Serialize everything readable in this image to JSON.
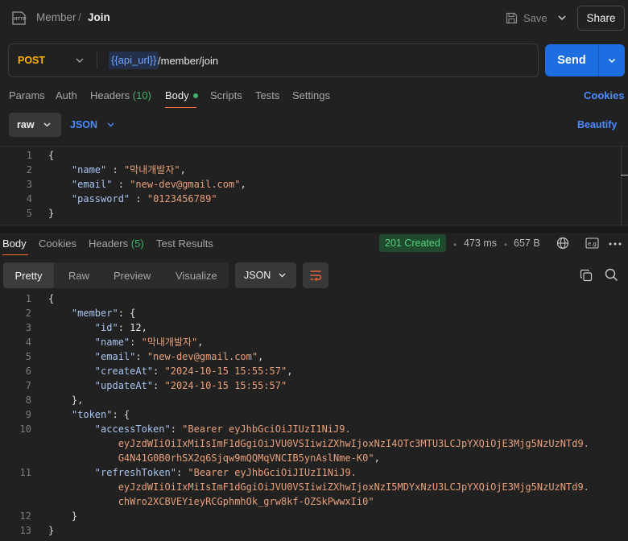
{
  "header": {
    "breadcrumb_parent": "Member",
    "breadcrumb_sep": "/",
    "breadcrumb_current": "Join",
    "save_label": "Save",
    "share_label": "Share",
    "http_icon": "http-icon"
  },
  "request": {
    "method": "POST",
    "url_variable": "{{api_url}}",
    "url_path": "/member/join",
    "send_label": "Send",
    "tabs": [
      {
        "label": "Params"
      },
      {
        "label": "Auth"
      },
      {
        "label": "Headers",
        "count": "(10)"
      },
      {
        "label": "Body"
      },
      {
        "label": "Scripts"
      },
      {
        "label": "Tests"
      },
      {
        "label": "Settings"
      }
    ],
    "cookies_label": "Cookies",
    "body_mode": "raw",
    "body_format": "JSON",
    "beautify_label": "Beautify",
    "body_lines": [
      {
        "n": "1",
        "parts": [
          [
            "p",
            "{"
          ]
        ]
      },
      {
        "n": "2",
        "parts": [
          [
            "p",
            "    "
          ],
          [
            "k",
            "\"name\""
          ],
          [
            "p",
            " : "
          ],
          [
            "s",
            "\"막내개발자\""
          ],
          [
            "p",
            ","
          ]
        ]
      },
      {
        "n": "3",
        "parts": [
          [
            "p",
            "    "
          ],
          [
            "k",
            "\"email\""
          ],
          [
            "p",
            " : "
          ],
          [
            "s",
            "\"new-dev@gmail.com\""
          ],
          [
            "p",
            ","
          ]
        ]
      },
      {
        "n": "4",
        "parts": [
          [
            "p",
            "    "
          ],
          [
            "k",
            "\"password\""
          ],
          [
            "p",
            " : "
          ],
          [
            "s",
            "\"0123456789\""
          ]
        ]
      },
      {
        "n": "5",
        "parts": [
          [
            "p",
            "}"
          ]
        ]
      }
    ]
  },
  "response": {
    "tabs": [
      {
        "label": "Body"
      },
      {
        "label": "Cookies"
      },
      {
        "label": "Headers",
        "count": "(5)"
      },
      {
        "label": "Test Results"
      }
    ],
    "status": "201 Created",
    "time": "473 ms",
    "size": "657 B",
    "view_modes": [
      "Pretty",
      "Raw",
      "Preview",
      "Visualize"
    ],
    "format": "JSON",
    "lines": [
      {
        "n": "1",
        "parts": [
          [
            "p",
            "{"
          ]
        ]
      },
      {
        "n": "2",
        "parts": [
          [
            "p",
            "    "
          ],
          [
            "k",
            "\"member\""
          ],
          [
            "p",
            ": {"
          ]
        ]
      },
      {
        "n": "3",
        "parts": [
          [
            "p",
            "        "
          ],
          [
            "k",
            "\"id\""
          ],
          [
            "p",
            ": "
          ],
          [
            "n",
            "12"
          ],
          [
            "p",
            ","
          ]
        ]
      },
      {
        "n": "4",
        "parts": [
          [
            "p",
            "        "
          ],
          [
            "k",
            "\"name\""
          ],
          [
            "p",
            ": "
          ],
          [
            "s",
            "\"막내개발자\""
          ],
          [
            "p",
            ","
          ]
        ]
      },
      {
        "n": "5",
        "parts": [
          [
            "p",
            "        "
          ],
          [
            "k",
            "\"email\""
          ],
          [
            "p",
            ": "
          ],
          [
            "s",
            "\"new-dev@gmail.com\""
          ],
          [
            "p",
            ","
          ]
        ]
      },
      {
        "n": "6",
        "parts": [
          [
            "p",
            "        "
          ],
          [
            "k",
            "\"createAt\""
          ],
          [
            "p",
            ": "
          ],
          [
            "s",
            "\"2024-10-15 15:55:57\""
          ],
          [
            "p",
            ","
          ]
        ]
      },
      {
        "n": "7",
        "parts": [
          [
            "p",
            "        "
          ],
          [
            "k",
            "\"updateAt\""
          ],
          [
            "p",
            ": "
          ],
          [
            "s",
            "\"2024-10-15 15:55:57\""
          ]
        ]
      },
      {
        "n": "8",
        "parts": [
          [
            "p",
            "    },"
          ]
        ]
      },
      {
        "n": "9",
        "parts": [
          [
            "p",
            "    "
          ],
          [
            "k",
            "\"token\""
          ],
          [
            "p",
            ": {"
          ]
        ]
      },
      {
        "n": "10",
        "parts": [
          [
            "p",
            "        "
          ],
          [
            "k",
            "\"accessToken\""
          ],
          [
            "p",
            ": "
          ],
          [
            "s",
            "\"Bearer eyJhbGciOiJIUzI1NiJ9."
          ]
        ]
      },
      {
        "n": "",
        "parts": [
          [
            "s",
            "            eyJzdWIiOiIxMiIsImF1dGgiOiJVU0VSIiwiZXhwIjoxNzI4OTc3MTU3LCJpYXQiOjE3Mjg5NzUzNTd9."
          ]
        ]
      },
      {
        "n": "",
        "parts": [
          [
            "s",
            "            G4N41G0B0rhSX2q6Sjqw9mQQMqVNCIB5ynAslNme-K0\""
          ],
          [
            "p",
            ","
          ]
        ]
      },
      {
        "n": "11",
        "parts": [
          [
            "p",
            "        "
          ],
          [
            "k",
            "\"refreshToken\""
          ],
          [
            "p",
            ": "
          ],
          [
            "s",
            "\"Bearer eyJhbGciOiJIUzI1NiJ9."
          ]
        ]
      },
      {
        "n": "",
        "parts": [
          [
            "s",
            "            eyJzdWIiOiIxMiIsImF1dGgiOiJVU0VSIiwiZXhwIjoxNzI5MDYxNzU3LCJpYXQiOjE3Mjg5NzUzNTd9."
          ]
        ]
      },
      {
        "n": "",
        "parts": [
          [
            "s",
            "            chWro2XCBVEYieyRCGphmhOk_grw8kf-OZSkPwwxIi0\""
          ]
        ]
      },
      {
        "n": "12",
        "parts": [
          [
            "p",
            "    }"
          ]
        ]
      },
      {
        "n": "13",
        "parts": [
          [
            "p",
            "}"
          ]
        ]
      }
    ]
  },
  "colors": {
    "accent_orange": "#ff6c37",
    "send_blue": "#1d6ee0",
    "link_blue": "#4a8cff",
    "method_yellow": "#ffb400",
    "status_green": "#53d27d",
    "json_key": "#a8c4f0",
    "json_string": "#e8a07a"
  },
  "icons": [
    "http-icon",
    "save-icon",
    "chevron-down-icon",
    "globe-icon",
    "example-icon",
    "more-icon",
    "wrap-lines-icon",
    "copy-icon",
    "search-icon"
  ]
}
